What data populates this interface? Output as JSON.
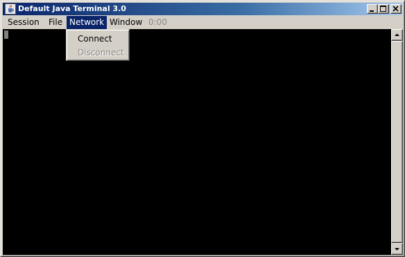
{
  "window": {
    "title": "Default Java Terminal 3.0",
    "icon": "java-cup-icon",
    "controls": [
      "minimize-icon",
      "maximize-icon",
      "close-icon"
    ]
  },
  "menubar": {
    "items": [
      {
        "label": "Session"
      },
      {
        "label": "File"
      },
      {
        "label": "Network",
        "state": "open"
      },
      {
        "label": "Window"
      },
      {
        "label": "0:00",
        "state": "disabled"
      }
    ]
  },
  "network_menu": {
    "items": [
      {
        "label": "Connect",
        "enabled": true
      },
      {
        "label": "Disconnect",
        "enabled": false
      }
    ]
  },
  "colors": {
    "title_gradient_start": "#0a246a",
    "title_gradient_end": "#a6caf0",
    "menu_highlight": "#0a246a",
    "terminal_background": "#000000",
    "chrome": "#d4d0c8",
    "disabled_text": "#8c8a84"
  }
}
